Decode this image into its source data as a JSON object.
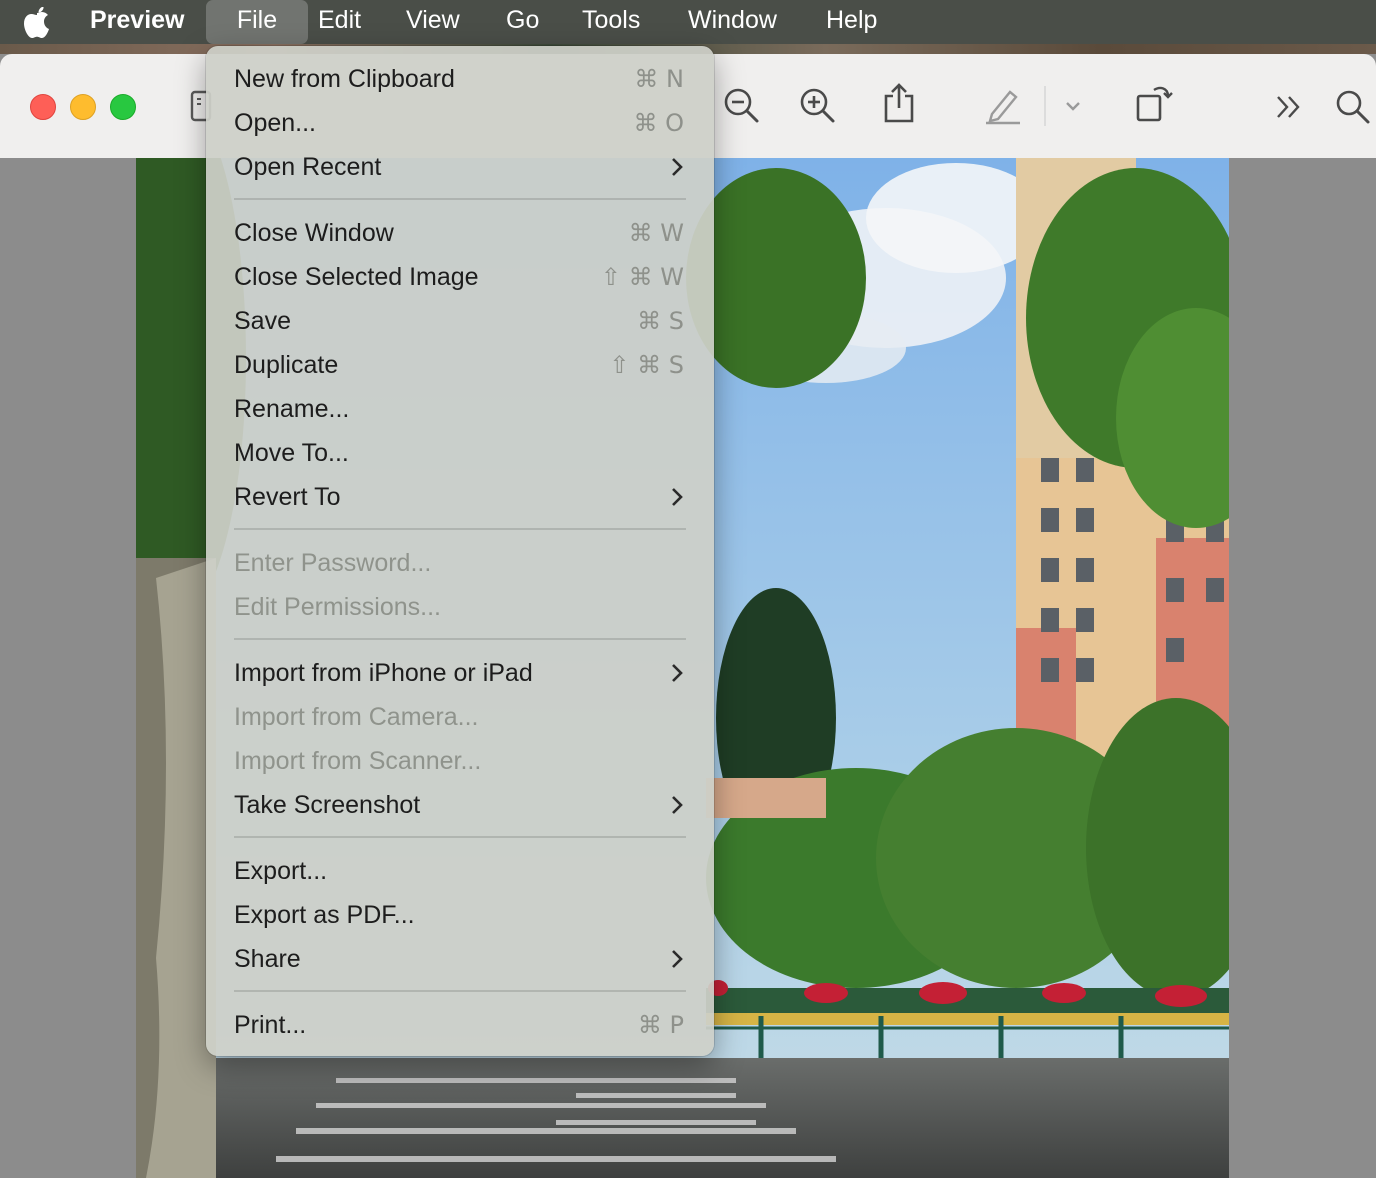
{
  "menubar": {
    "app_name": "Preview",
    "items": [
      "File",
      "Edit",
      "View",
      "Go",
      "Tools",
      "Window",
      "Help"
    ],
    "active_item": "File"
  },
  "toolbar": {
    "icons": [
      "sidebar-icon",
      "zoom-out-icon",
      "zoom-in-icon",
      "share-icon",
      "markup-pen-icon",
      "chevron-down-icon",
      "rotate-icon",
      "more-icon",
      "search-icon"
    ]
  },
  "file_menu": {
    "groups": [
      [
        {
          "label": "New from Clipboard",
          "shortcut": "⌘ N",
          "enabled": true
        },
        {
          "label": "Open...",
          "shortcut": "⌘ O",
          "enabled": true
        },
        {
          "label": "Open Recent",
          "submenu": true,
          "enabled": true
        }
      ],
      [
        {
          "label": "Close Window",
          "shortcut": "⌘ W",
          "enabled": true
        },
        {
          "label": "Close Selected Image",
          "shortcut": "⇧ ⌘ W",
          "enabled": true
        },
        {
          "label": "Save",
          "shortcut": "⌘ S",
          "enabled": true
        },
        {
          "label": "Duplicate",
          "shortcut": "⇧ ⌘ S",
          "enabled": true
        },
        {
          "label": "Rename...",
          "enabled": true
        },
        {
          "label": "Move To...",
          "enabled": true
        },
        {
          "label": "Revert To",
          "submenu": true,
          "enabled": true
        }
      ],
      [
        {
          "label": "Enter Password...",
          "enabled": false
        },
        {
          "label": "Edit Permissions...",
          "enabled": false
        }
      ],
      [
        {
          "label": "Import from iPhone or iPad",
          "submenu": true,
          "enabled": true
        },
        {
          "label": "Import from Camera...",
          "enabled": false
        },
        {
          "label": "Import from Scanner...",
          "enabled": false
        },
        {
          "label": "Take Screenshot",
          "submenu": true,
          "enabled": true
        }
      ],
      [
        {
          "label": "Export...",
          "enabled": true
        },
        {
          "label": "Export as PDF...",
          "enabled": true
        },
        {
          "label": "Share",
          "submenu": true,
          "enabled": true
        }
      ],
      [
        {
          "label": "Print...",
          "shortcut": "⌘ P",
          "enabled": true
        }
      ]
    ]
  },
  "colors": {
    "menubar_bg": "#4a4e48",
    "close": "#fe5f57",
    "minimize": "#febc2e",
    "zoom": "#28c840"
  }
}
